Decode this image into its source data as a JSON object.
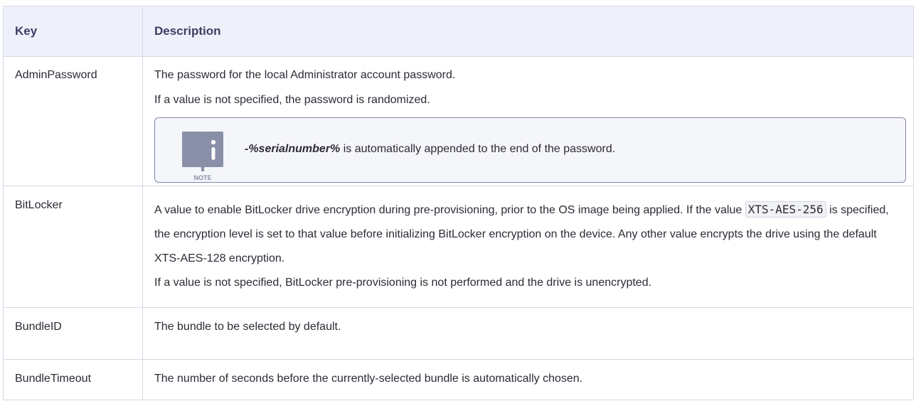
{
  "table": {
    "headers": {
      "key": "Key",
      "description": "Description"
    },
    "rows": {
      "admin": {
        "key": "AdminPassword",
        "p1": "The password for the local Administrator account password.",
        "p2": "If a value is not specified, the password is randomized.",
        "note": {
          "icon_label": "NOTE",
          "bold": "-%serialnumber%",
          "text": " is automatically appended to the end of the password."
        }
      },
      "bitlocker": {
        "key": "BitLocker",
        "p1_before": "A value to enable BitLocker drive encryption during pre-provisioning, prior to the OS image being applied. If the value ",
        "code": "XTS-AES-256",
        "p1_after": " is specified, the encryption level is set to that value before initializing BitLocker encryption on the device. Any other value encrypts the drive using the default XTS-AES-128 encryption.",
        "p2": "If a value is not specified, BitLocker pre-provisioning is not performed and the drive is unencrypted."
      },
      "bundleid": {
        "key": "BundleID",
        "desc": "The bundle to be selected by default."
      },
      "bundletimeout": {
        "key": "BundleTimeout",
        "desc": "The number of seconds before the currently-selected bundle is automatically chosen."
      }
    },
    "colors": {
      "header_bg": "#eef1fa",
      "header_text": "#3b3f63",
      "border": "#d5d9e6",
      "note_border": "#7f86a8",
      "note_icon": "#8a8fa8"
    }
  }
}
